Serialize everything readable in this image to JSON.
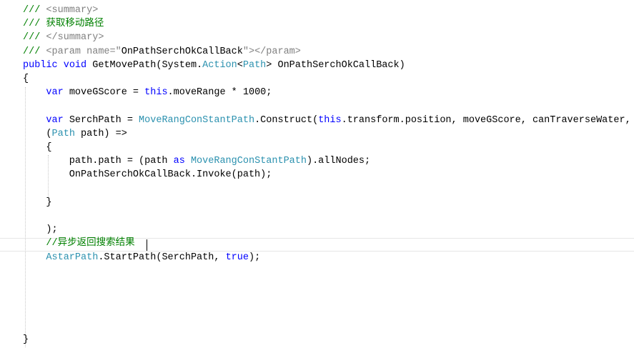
{
  "editor": {
    "lines": [
      {
        "tokens": [
          {
            "t": "/// ",
            "c": "t-cmt"
          },
          {
            "t": "<summary>",
            "c": "t-xml"
          }
        ]
      },
      {
        "tokens": [
          {
            "t": "/// ",
            "c": "t-cmt"
          },
          {
            "t": "获取移动路径",
            "c": "t-cmt"
          }
        ]
      },
      {
        "tokens": [
          {
            "t": "/// ",
            "c": "t-cmt"
          },
          {
            "t": "</summary>",
            "c": "t-xml"
          }
        ]
      },
      {
        "tokens": [
          {
            "t": "/// ",
            "c": "t-cmt"
          },
          {
            "t": "<param name=\"",
            "c": "t-xml"
          },
          {
            "t": "OnPathSerchOkCallBack",
            "c": "t-plain"
          },
          {
            "t": "\"></param>",
            "c": "t-xml"
          }
        ]
      },
      {
        "tokens": [
          {
            "t": "public",
            "c": "t-kw"
          },
          {
            "t": " ",
            "c": "t-plain"
          },
          {
            "t": "void",
            "c": "t-kw"
          },
          {
            "t": " GetMovePath(System.",
            "c": "t-plain"
          },
          {
            "t": "Action",
            "c": "t-type"
          },
          {
            "t": "<",
            "c": "t-plain"
          },
          {
            "t": "Path",
            "c": "t-type"
          },
          {
            "t": "> OnPathSerchOkCallBack)",
            "c": "t-plain"
          }
        ]
      },
      {
        "tokens": [
          {
            "t": "{",
            "c": "t-plain"
          }
        ]
      },
      {
        "tokens": [
          {
            "t": "    ",
            "c": "t-plain"
          },
          {
            "t": "var",
            "c": "t-kw"
          },
          {
            "t": " moveGScore = ",
            "c": "t-plain"
          },
          {
            "t": "this",
            "c": "t-kw"
          },
          {
            "t": ".moveRange * 1000;",
            "c": "t-plain"
          }
        ]
      },
      {
        "tokens": []
      },
      {
        "tokens": [
          {
            "t": "    ",
            "c": "t-plain"
          },
          {
            "t": "var",
            "c": "t-kw"
          },
          {
            "t": " SerchPath = ",
            "c": "t-plain"
          },
          {
            "t": "MoveRangConStantPath",
            "c": "t-type"
          },
          {
            "t": ".Construct(",
            "c": "t-plain"
          },
          {
            "t": "this",
            "c": "t-kw"
          },
          {
            "t": ".transform.position, moveGScore, canTraverseWater,",
            "c": "t-plain"
          }
        ]
      },
      {
        "tokens": [
          {
            "t": "    (",
            "c": "t-plain"
          },
          {
            "t": "Path",
            "c": "t-type"
          },
          {
            "t": " path) =>",
            "c": "t-plain"
          }
        ]
      },
      {
        "tokens": [
          {
            "t": "    {",
            "c": "t-plain"
          }
        ]
      },
      {
        "tokens": [
          {
            "t": "        path.path = (path ",
            "c": "t-plain"
          },
          {
            "t": "as",
            "c": "t-kw"
          },
          {
            "t": " ",
            "c": "t-plain"
          },
          {
            "t": "MoveRangConStantPath",
            "c": "t-type"
          },
          {
            "t": ").allNodes;",
            "c": "t-plain"
          }
        ]
      },
      {
        "tokens": [
          {
            "t": "        OnPathSerchOkCallBack.Invoke(path);",
            "c": "t-plain"
          }
        ]
      },
      {
        "tokens": []
      },
      {
        "tokens": [
          {
            "t": "    }",
            "c": "t-plain"
          }
        ]
      },
      {
        "tokens": []
      },
      {
        "tokens": [
          {
            "t": "    );",
            "c": "t-plain"
          }
        ]
      },
      {
        "tokens": [
          {
            "t": "    ",
            "c": "t-plain"
          },
          {
            "t": "//异步返回搜索结果",
            "c": "t-cmt"
          }
        ]
      },
      {
        "tokens": [
          {
            "t": "    ",
            "c": "t-plain"
          },
          {
            "t": "AstarPath",
            "c": "t-type"
          },
          {
            "t": ".StartPath(SerchPath, ",
            "c": "t-plain"
          },
          {
            "t": "true",
            "c": "t-kw"
          },
          {
            "t": ");",
            "c": "t-plain"
          }
        ]
      },
      {
        "tokens": []
      },
      {
        "tokens": []
      },
      {
        "tokens": []
      },
      {
        "tokens": []
      },
      {
        "tokens": []
      },
      {
        "tokens": [
          {
            "t": "}",
            "c": "t-plain"
          }
        ]
      }
    ],
    "current_line_index": 17
  }
}
